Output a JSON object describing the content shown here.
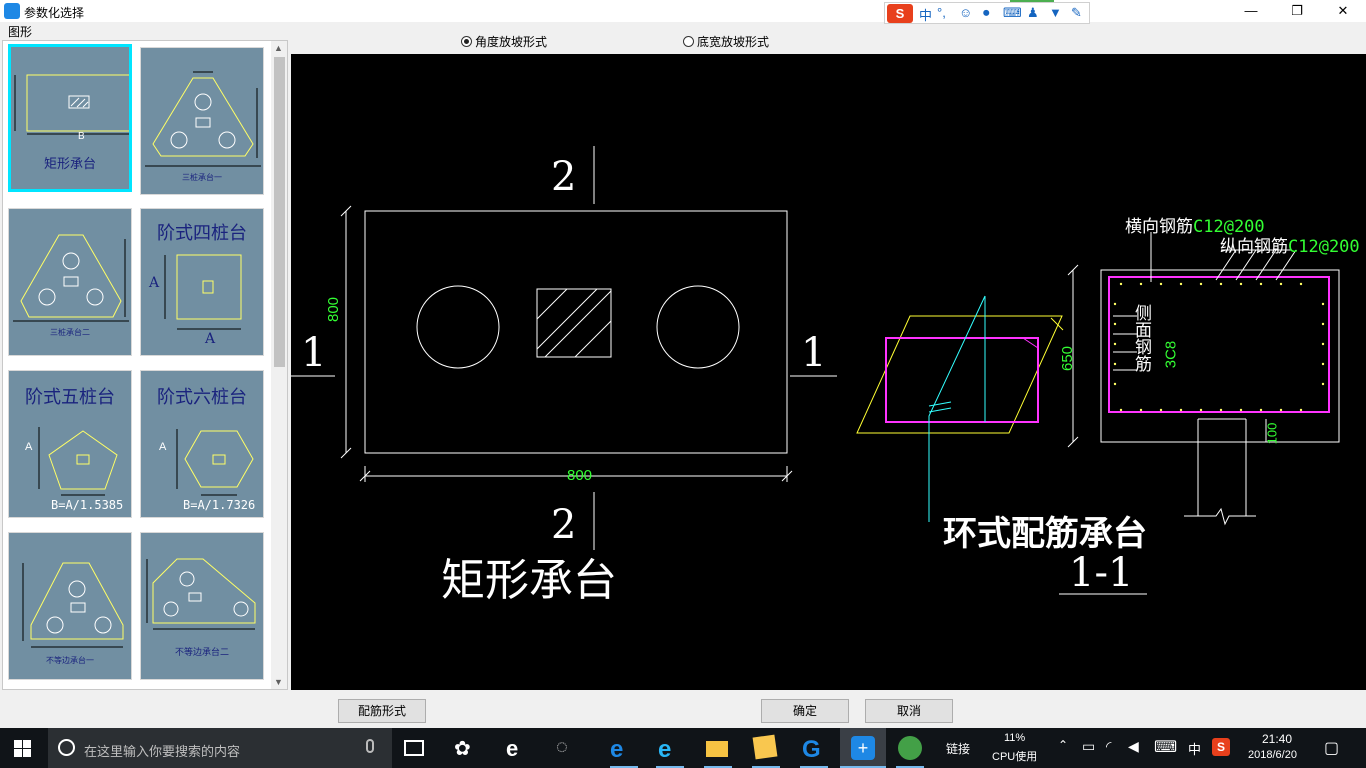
{
  "window": {
    "title": "参数化选择",
    "minimize": "—",
    "maximize": "❐",
    "close": "✕"
  },
  "ime": {
    "logo": "S",
    "lang": "中",
    "punct": "°,"
  },
  "left": {
    "label": "图形",
    "thumbs": [
      {
        "title": "矩形承台",
        "dim": "B"
      },
      {
        "title": "三桩承台一"
      },
      {
        "title": "三桩承台二"
      },
      {
        "title": "阶式四桩台",
        "dim_a": "A",
        "dim_b": "A"
      },
      {
        "title": "阶式五桩台",
        "dim_a": "A",
        "formula": "B=A/1.5385"
      },
      {
        "title": "阶式六桩台",
        "dim_a": "A",
        "formula": "B=A/1.7326"
      },
      {
        "title": "不等边承台一"
      },
      {
        "title": "不等边承台二"
      }
    ]
  },
  "radio": {
    "angle": "角度放坡形式",
    "width": "底宽放坡形式",
    "selected": "angle"
  },
  "cad": {
    "dim_horizontal": "800",
    "dim_vertical": "800",
    "section_top": "2",
    "section_bottom": "2",
    "section_left": "1",
    "section_right": "1",
    "title_rect": "矩形承台",
    "title_ring": "环式配筋承台",
    "section_label": "1-1",
    "rebar_h_label": "横向钢筋",
    "rebar_h_value": "C12@200",
    "rebar_v_label": "纵向钢筋",
    "rebar_v_value": "C12@200",
    "side_rebar_label": "侧面钢筋",
    "side_rebar_value": "3C8",
    "height_dim": "650",
    "cover_dim": "100"
  },
  "buttons": {
    "rebar_form": "配筋形式",
    "ok": "确定",
    "cancel": "取消"
  },
  "taskbar": {
    "search_placeholder": "在这里输入你要搜索的内容",
    "link": "链接",
    "cpu_percent": "11%",
    "cpu_label": "CPU使用",
    "ime_lang": "中",
    "time": "21:40",
    "date": "2018/6/20"
  }
}
